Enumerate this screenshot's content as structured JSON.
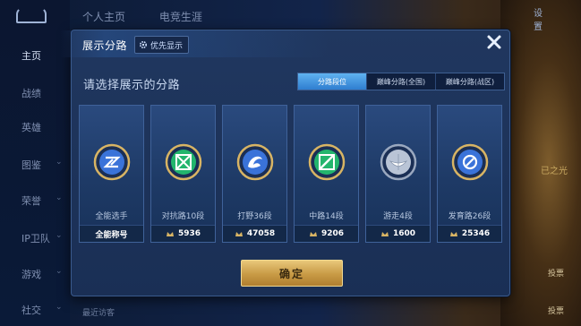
{
  "background": {
    "nav": [
      {
        "label": "主页",
        "chev": ""
      },
      {
        "label": "战绩",
        "chev": ""
      },
      {
        "label": "英雄",
        "chev": ""
      },
      {
        "label": "图鉴",
        "chev": "⌄"
      },
      {
        "label": "荣誉",
        "chev": "⌄"
      },
      {
        "label": "IP卫队",
        "chev": "⌄"
      },
      {
        "label": "游戏",
        "chev": "⌄"
      },
      {
        "label": "社交",
        "chev": "⌄"
      }
    ],
    "tabs": [
      "个人主页",
      "电竞生涯"
    ],
    "settings_label": "设置",
    "bottom_text": "最近访客",
    "right_texts": [
      "已之光",
      "投票",
      "投票"
    ]
  },
  "dialog": {
    "title": "展示分路",
    "priority_label": "优先显示",
    "subtitle": "请选择展示的分路",
    "segments": [
      {
        "label": "分路段位",
        "active": true
      },
      {
        "label": "巅峰分路(全国)",
        "active": false
      },
      {
        "label": "巅峰分路(战区)",
        "active": false
      }
    ],
    "roles": [
      {
        "name": "全能选手",
        "value": "全能称号",
        "icon": "allround-badge-icon",
        "accent": "#3a73d9",
        "show_crown": false
      },
      {
        "name": "对抗路10段",
        "value": "5936",
        "icon": "clash-lane-badge-icon",
        "accent": "#23b56d",
        "show_crown": true
      },
      {
        "name": "打野36段",
        "value": "47058",
        "icon": "jungle-badge-icon",
        "accent": "#3a73d9",
        "show_crown": true
      },
      {
        "name": "中路14段",
        "value": "9206",
        "icon": "mid-lane-badge-icon",
        "accent": "#23b56d",
        "show_crown": true
      },
      {
        "name": "游走4段",
        "value": "1600",
        "icon": "roam-badge-icon",
        "accent": "#b9c4d6",
        "show_crown": true
      },
      {
        "name": "发育路26段",
        "value": "25346",
        "icon": "farm-lane-badge-icon",
        "accent": "#3a73d9",
        "show_crown": true
      }
    ],
    "confirm_label": "确定"
  },
  "colors": {
    "gold": "#d8b464",
    "accent_blue": "#3f8fe0"
  }
}
